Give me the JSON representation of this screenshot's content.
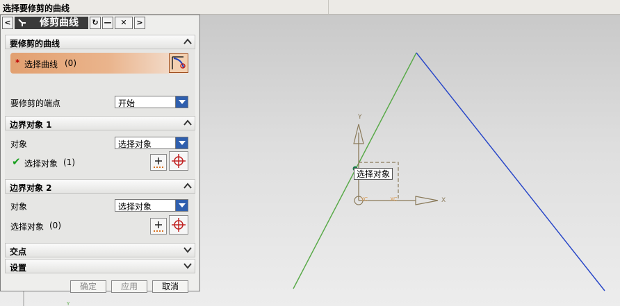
{
  "prompt": {
    "text": "选择要修剪的曲线"
  },
  "dialog": {
    "title": "修剪曲线",
    "sections": {
      "curve": {
        "title": "要修剪的曲线",
        "select_label": "选择曲线",
        "select_count": "(0)",
        "required_mark": "*",
        "endpoint_label": "要修剪的端点",
        "endpoint_value": "开始"
      },
      "boundary1": {
        "title": "边界对象 1",
        "object_label": "对象",
        "object_value": "选择对象",
        "select_label": "选择对象",
        "select_count": "(1)"
      },
      "boundary2": {
        "title": "边界对象 2",
        "object_label": "对象",
        "object_value": "选择对象",
        "select_label": "选择对象",
        "select_count": "(0)"
      },
      "intersection": {
        "title": "交点"
      },
      "settings": {
        "title": "设置"
      }
    },
    "buttons": {
      "ok": "确定",
      "apply": "应用",
      "cancel": "取消"
    }
  },
  "viewport": {
    "tooltip": "选择对象",
    "axis_x": "X",
    "axis_y": "Y",
    "axis_xc": "XC",
    "axis_yc": "YC",
    "colors": {
      "green_curve": "#5aaa4a",
      "blue_curve": "#2a48c8",
      "axis": "#8a7a5a"
    }
  }
}
